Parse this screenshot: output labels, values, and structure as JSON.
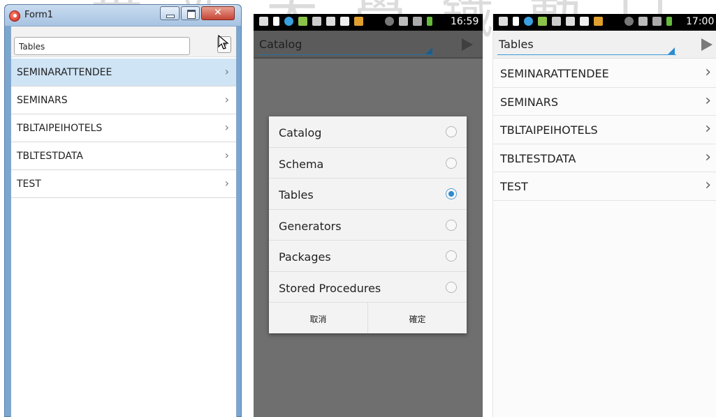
{
  "watermark": "世 新 大 學 鐵 動 口",
  "form_window": {
    "title": "Form1",
    "combo_value": "Tables",
    "items": [
      "SEMINARATTENDEE",
      "SEMINARS",
      "TBLTAIPEIHOTELS",
      "TBLTESTDATA",
      "TEST"
    ],
    "selected_index": 0
  },
  "phone_dialog": {
    "status_time": "16:59",
    "spinner_value": "Catalog",
    "options": [
      "Catalog",
      "Schema",
      "Tables",
      "Generators",
      "Packages",
      "Stored Procedures"
    ],
    "selected_option": "Tables",
    "cancel_label": "取消",
    "ok_label": "確定"
  },
  "phone_list": {
    "status_time": "17:00",
    "spinner_value": "Tables",
    "items": [
      "SEMINARATTENDEE",
      "SEMINARS",
      "TBLTAIPEIHOTELS",
      "TBLTESTDATA",
      "TEST"
    ]
  },
  "colors": {
    "accent_blue": "#2d8bd0",
    "status_bar": "#000000"
  },
  "icons": {
    "chevron": "chevron-right-icon",
    "play": "play-icon",
    "radio": "radio-icon"
  }
}
